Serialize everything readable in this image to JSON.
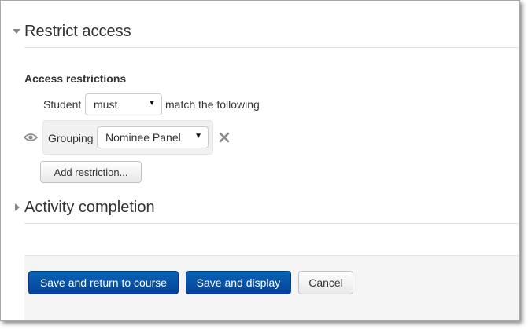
{
  "restrict_section": {
    "title": "Restrict access",
    "access_restrictions_label": "Access restrictions",
    "student_label": "Student",
    "must_select": "must",
    "match_label": "match the following",
    "condition": {
      "type_label": "Grouping",
      "grouping_select": "Nominee Panel"
    },
    "add_restriction_label": "Add restriction..."
  },
  "completion_section": {
    "title": "Activity completion"
  },
  "footer": {
    "save_return_label": "Save and return to course",
    "save_display_label": "Save and display",
    "cancel_label": "Cancel"
  },
  "colors": {
    "primary_button": "#05429a",
    "footer_bg": "#f5f5f5",
    "condition_bg": "#f1f1f1"
  },
  "icons": [
    "chevron-down-icon",
    "eye-icon",
    "close-icon",
    "chevron-right-icon",
    "caret-down-icon"
  ]
}
